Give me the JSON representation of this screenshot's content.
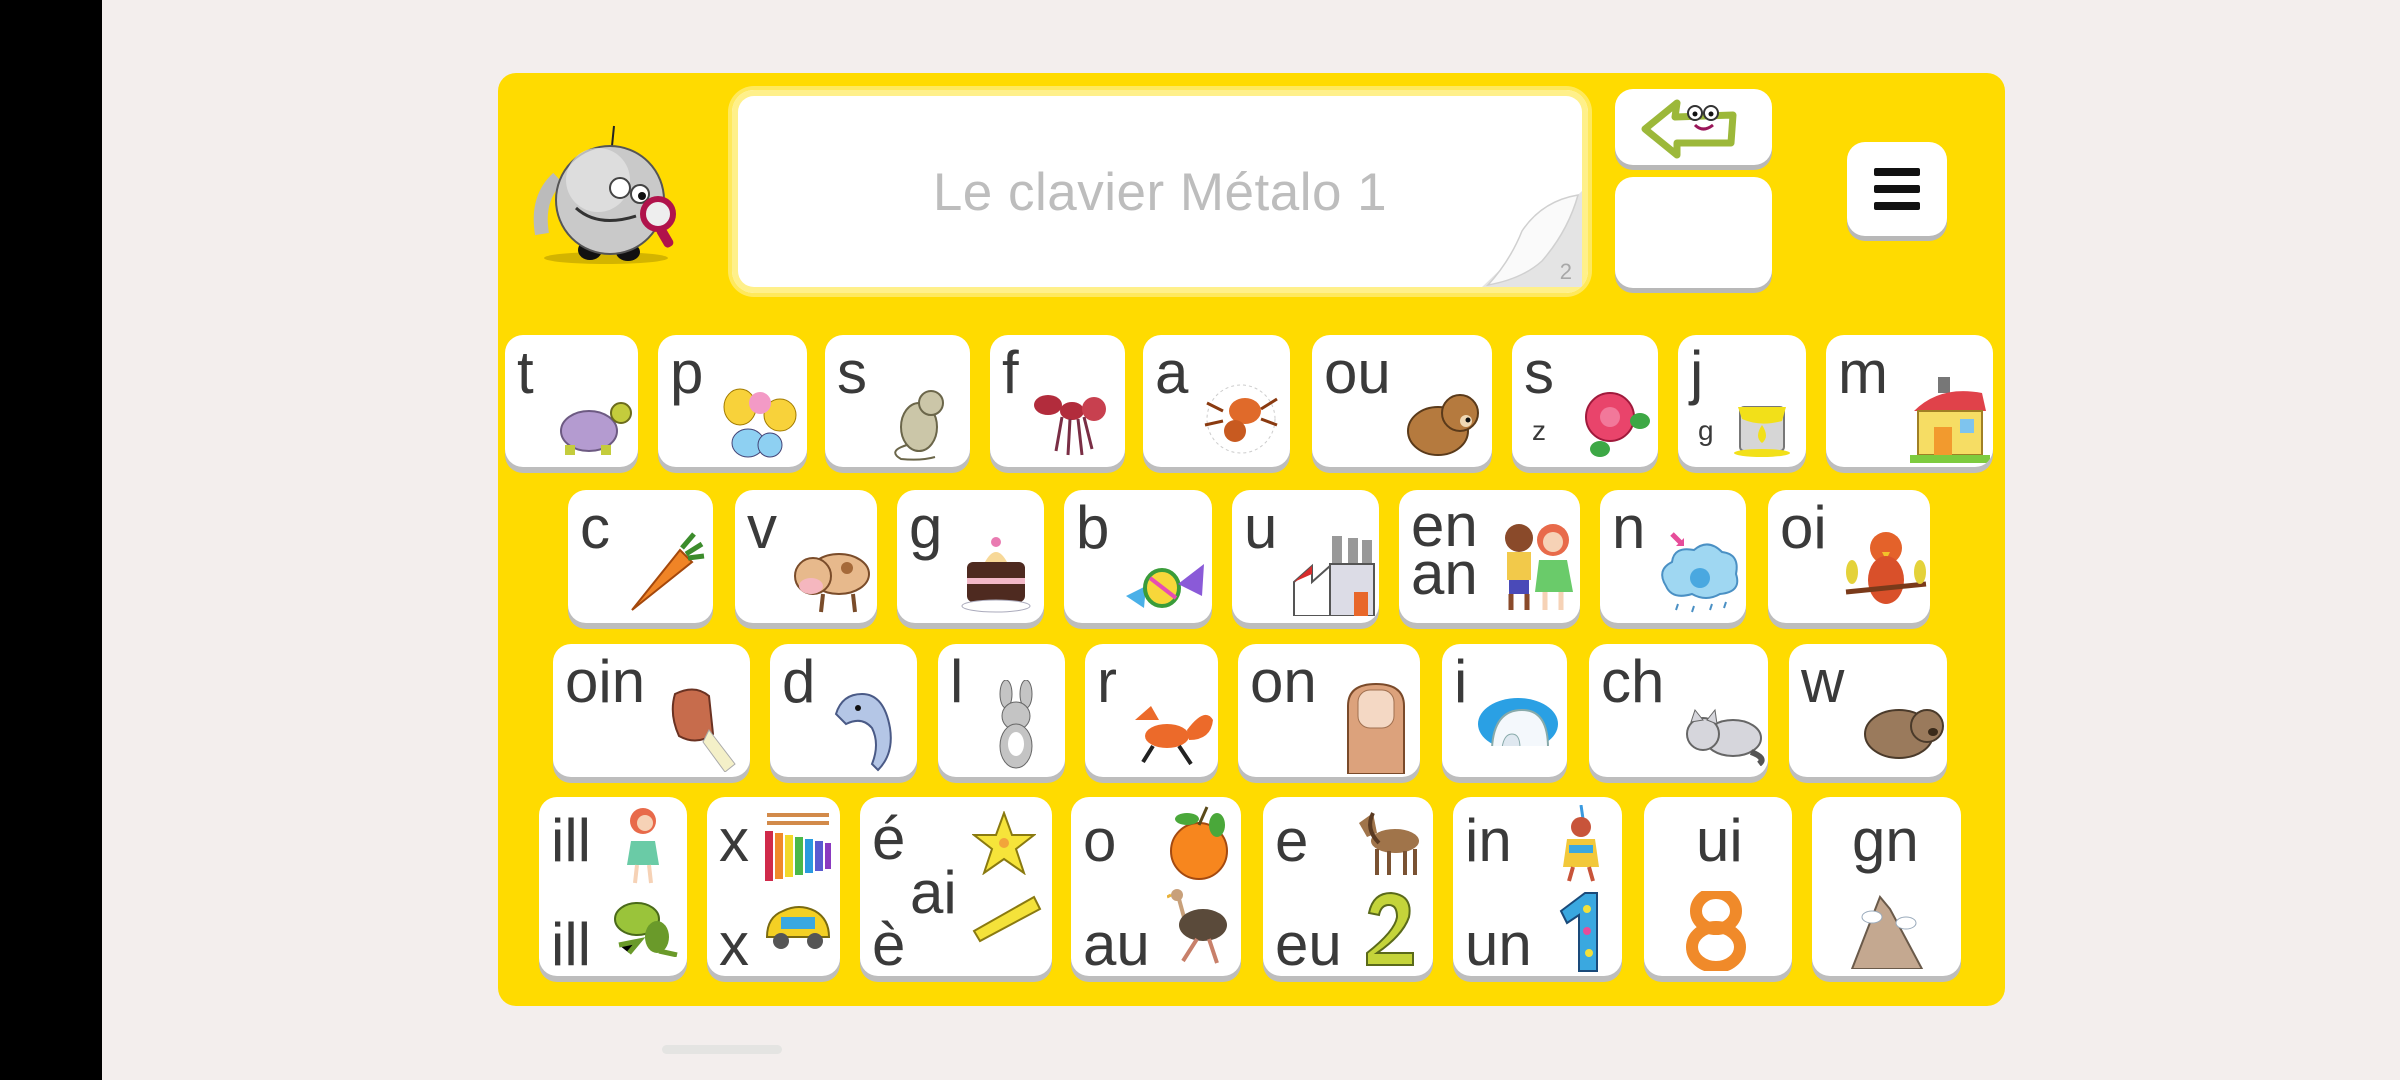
{
  "app": {
    "title": "Le clavier Métalo 1",
    "page_number": "2",
    "panel_color": "#ffdb00",
    "key_text_color": "#3a3a3a"
  },
  "toolbar": {
    "mascot_icon": "robot-magnifier-icon",
    "backspace_icon": "smiling-arrow-left-icon",
    "blank_button_label": "",
    "menu_icon": "hamburger-menu-icon"
  },
  "keyboard": {
    "rows": [
      [
        {
          "labels": [
            "t"
          ],
          "picture": "turtle"
        },
        {
          "labels": [
            "p"
          ],
          "picture": "butterfly"
        },
        {
          "labels": [
            "s"
          ],
          "picture": "mouse"
        },
        {
          "labels": [
            "f"
          ],
          "picture": "ant"
        },
        {
          "labels": [
            "a"
          ],
          "picture": "spider"
        },
        {
          "labels": [
            "ou"
          ],
          "picture": "bear"
        },
        {
          "labels": [
            "s",
            "z"
          ],
          "picture": "rose"
        },
        {
          "labels": [
            "j",
            "g"
          ],
          "picture": "paint-can"
        },
        {
          "labels": [
            "m"
          ],
          "picture": "house"
        }
      ],
      [
        {
          "labels": [
            "c"
          ],
          "picture": "carrot"
        },
        {
          "labels": [
            "v"
          ],
          "picture": "cow"
        },
        {
          "labels": [
            "g"
          ],
          "picture": "cake"
        },
        {
          "labels": [
            "b"
          ],
          "picture": "candy"
        },
        {
          "labels": [
            "u"
          ],
          "picture": "factory"
        },
        {
          "labels": [
            "en",
            "an"
          ],
          "picture": "children"
        },
        {
          "labels": [
            "n"
          ],
          "picture": "cloud"
        },
        {
          "labels": [
            "oi"
          ],
          "picture": "bird"
        }
      ],
      [
        {
          "labels": [
            "oin"
          ],
          "picture": "fist"
        },
        {
          "labels": [
            "d"
          ],
          "picture": "dolphin"
        },
        {
          "labels": [
            "l"
          ],
          "picture": "rabbit"
        },
        {
          "labels": [
            "r"
          ],
          "picture": "fox"
        },
        {
          "labels": [
            "on"
          ],
          "picture": "thumb"
        },
        {
          "labels": [
            "i"
          ],
          "picture": "igloo"
        },
        {
          "labels": [
            "ch"
          ],
          "picture": "cat"
        },
        {
          "labels": [
            "w"
          ],
          "picture": "wombat"
        }
      ],
      [
        {
          "labels": [
            "ill",
            "ill"
          ],
          "picture": "girl-frog"
        },
        {
          "labels": [
            "x",
            "x"
          ],
          "picture": "xylophone-taxi"
        },
        {
          "labels": [
            "é",
            "ai",
            "è"
          ],
          "picture": "star-ruler"
        },
        {
          "labels": [
            "o",
            "au"
          ],
          "picture": "orange-ostrich"
        },
        {
          "labels": [
            "e",
            "eu"
          ],
          "picture": "horse-two"
        },
        {
          "labels": [
            "in",
            "un"
          ],
          "picture": "native-one"
        },
        {
          "labels": [
            "ui"
          ],
          "picture": "eight"
        },
        {
          "labels": [
            "gn"
          ],
          "picture": "mountain"
        }
      ]
    ]
  }
}
